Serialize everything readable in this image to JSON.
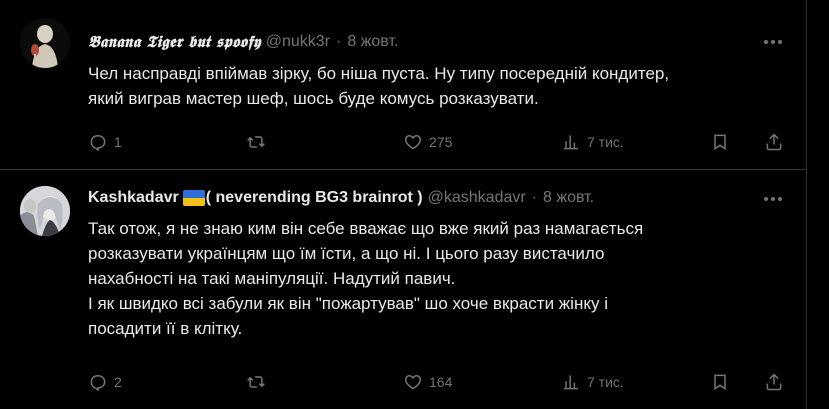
{
  "tweets": [
    {
      "author_name": "𝕭𝖆𝖓𝖆𝖓𝖆 𝕿𝖎𝖌𝖊𝖗 𝖇𝖚𝖙 𝖘𝖕𝖔𝖔𝖋𝖞",
      "handle": "@nukk3r",
      "separator": "·",
      "date": "8 жовт.",
      "lines": [
        "Чел насправді впіймав зірку, бо ніша пуста. Ну типу посередній кондитер,",
        "який виграв мастер шеф, шось буде комусь розказувати."
      ],
      "replies": "1",
      "retweets": "",
      "likes": "275",
      "views": "7 тис."
    },
    {
      "author_name": "Kashkadavr",
      "author_suffix": "( neverending BG3 brainrot )",
      "handle": "@kashkadavr",
      "separator": "·",
      "date": "8 жовт.",
      "lines": [
        "Так отож, я не знаю ким він себе вважає що вже який раз намагається",
        "розказувати українцям що їм їсти, а що ні. І цього разу вистачило",
        "нахабності на такі маніпуляції.  Надутий павич.",
        "І як швидко всі забули як він \"пожартував\" шо хоче вкрасти жінку і",
        "посадити її в клітку."
      ],
      "replies": "2",
      "retweets": "",
      "likes": "164",
      "views": "7 тис."
    }
  ],
  "icons": [
    "reply-icon",
    "retweet-icon",
    "like-icon",
    "views-icon",
    "bookmark-icon",
    "share-icon",
    "more-icon",
    "ukraine-flag-icon"
  ],
  "colors": {
    "background": "#000000",
    "text": "#e7e9ea",
    "muted": "#71767b",
    "divider": "#2f3336"
  }
}
